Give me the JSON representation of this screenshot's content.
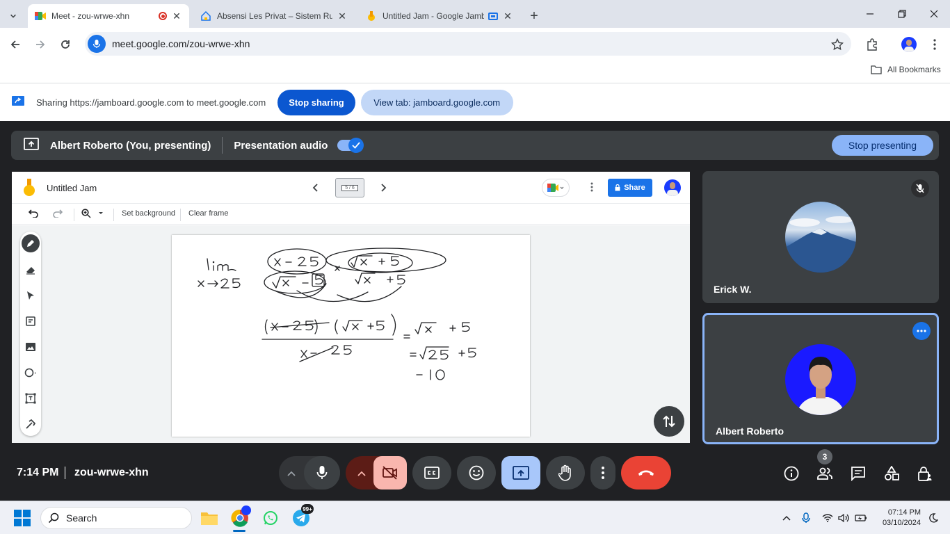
{
  "browser": {
    "tabs": [
      {
        "title": "Meet - zou-wrwe-xhn",
        "active": true
      },
      {
        "title": "Absensi Les Privat – Sistem Ruan",
        "active": false
      },
      {
        "title": "Untitled Jam - Google Jamb",
        "active": false
      }
    ],
    "url": "meet.google.com/zou-wrwe-xhn",
    "bookmarks_label": "All Bookmarks"
  },
  "sharing": {
    "text": "Sharing https://jamboard.google.com to meet.google.com",
    "stop_label": "Stop sharing",
    "view_tab_label": "View tab: jamboard.google.com"
  },
  "meet": {
    "presenter_label": "Albert Roberto (You, presenting)",
    "audio_label": "Presentation audio",
    "stop_presenting_label": "Stop presenting",
    "time": "7:14 PM",
    "meeting_code": "zou-wrwe-xhn",
    "participants_count": "3",
    "participants": [
      {
        "name": "Erick W.",
        "muted": true
      },
      {
        "name": "Albert Roberto",
        "muted": false
      }
    ]
  },
  "jamboard": {
    "title": "Untitled Jam",
    "frame_indicator": "5 / 6",
    "share_label": "Share",
    "set_background_label": "Set background",
    "clear_frame_label": "Clear frame"
  },
  "taskbar": {
    "search_placeholder": "Search",
    "badge": "99+",
    "time": "07:14 PM",
    "date": "03/10/2024"
  },
  "colors": {
    "accent": "#1a73e8",
    "meet_bg": "#202124",
    "tile_bg": "#3c4043",
    "end_call": "#ea4335",
    "camera_off": "#f9b6ae"
  }
}
